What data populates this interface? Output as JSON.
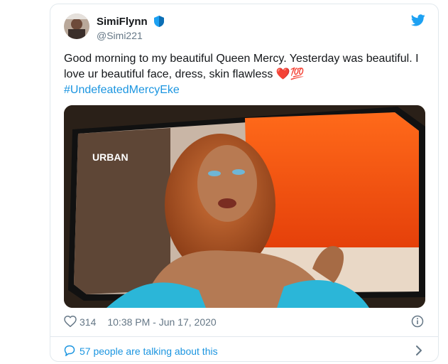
{
  "user": {
    "name": "SimiFlynn",
    "handle": "@Simi221"
  },
  "tweet": {
    "text": "Good morning to my beautiful Queen Mercy. Yesterday was beautiful. I love ur beautiful face, dress, skin flawless",
    "emoji": "❤️💯",
    "hashtag": "#UndefeatedMercyEke",
    "media_channel_logo": "URBAN"
  },
  "stats": {
    "likes": "314",
    "timestamp": "10:38 PM - Jun 17, 2020"
  },
  "footer": {
    "talking": "57 people are talking about this"
  },
  "colors": {
    "accent": "#1b95e0",
    "muted": "#657786",
    "heart": "#e0245e",
    "twitter": "#1da1f2"
  }
}
